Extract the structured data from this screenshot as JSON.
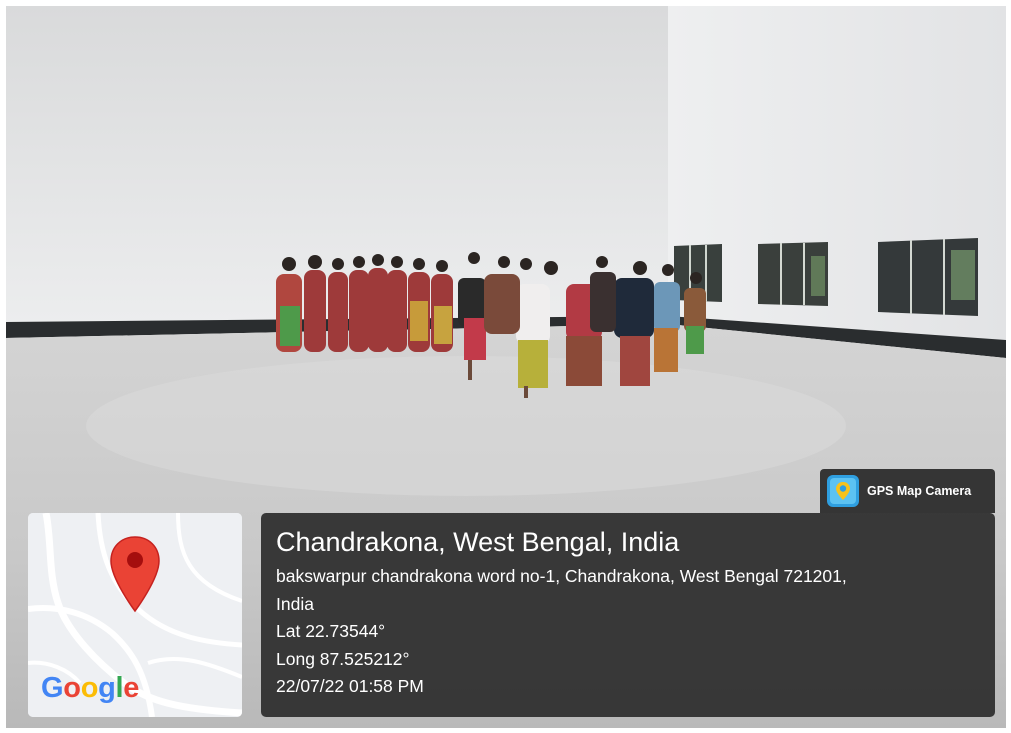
{
  "overlay": {
    "app_badge": {
      "label": "GPS Map Camera",
      "icon": "gps-map-camera-app-icon"
    },
    "map": {
      "provider_logo": "Google",
      "marker_icon": "map-pin-icon",
      "logo_colors": [
        "#4285F4",
        "#EA4335",
        "#FBBC05",
        "#4285F4",
        "#34A853",
        "#EA4335"
      ]
    },
    "location": {
      "place": "Chandrakona, West Bengal, India",
      "address_line1": "bakswarpur chandrakona word no-1, Chandrakona, West Bengal 721201,",
      "address_line2": "India",
      "lat": "Lat 22.73544°",
      "long": "Long 87.525212°",
      "timestamp": "22/07/22 01:58 PM"
    }
  },
  "colors": {
    "panel_bg": "#2d2d2d",
    "pin_red": "#EA4335",
    "wall": "#e3e4e5",
    "floor": "#cfcfcf"
  }
}
